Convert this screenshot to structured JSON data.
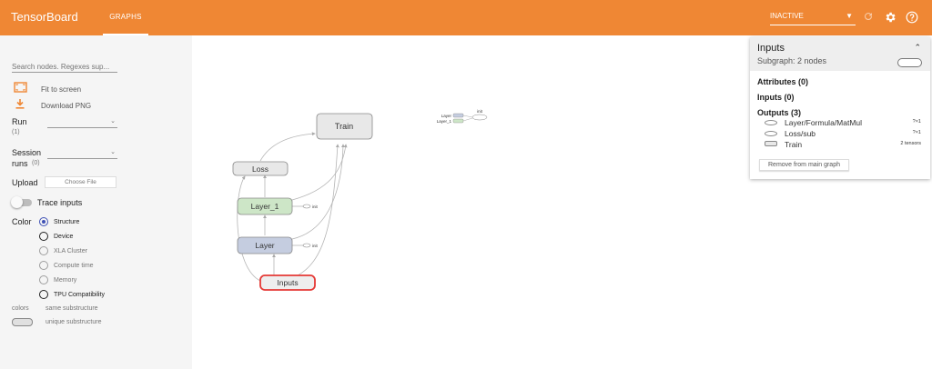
{
  "app": {
    "title": "TensorBoard",
    "tab": "GRAPHS"
  },
  "topbar": {
    "run_state": "INACTIVE",
    "icons": [
      "refresh-icon",
      "gear-icon",
      "help-icon"
    ]
  },
  "sidebar": {
    "search_placeholder": "Search nodes. Regexes sup...",
    "fit_label": "Fit to screen",
    "download_label": "Download PNG",
    "run_label": "Run",
    "run_count": "(1)",
    "session_label_1": "Session",
    "session_label_2": "runs",
    "session_count": "(0)",
    "upload_label": "Upload",
    "choose_file": "Choose File",
    "trace_label": "Trace inputs",
    "color_label": "Color",
    "color_options": [
      "Structure",
      "Device",
      "XLA Cluster",
      "Compute time",
      "Memory",
      "TPU Compatibility"
    ],
    "colors_label": "colors",
    "same_sub": "same substructure",
    "unique_sub": "unique substructure"
  },
  "graph": {
    "nodes": {
      "train": "Train",
      "loss": "Loss",
      "layer1": "Layer_1",
      "layer": "Layer",
      "inputs": "Inputs"
    },
    "init_label": "init",
    "mini_layer": "Layer",
    "mini_layer1": "Layer_1",
    "mini_init": "init",
    "edge_labels": {
      "shape_label": "?×1"
    }
  },
  "panel": {
    "title": "Inputs",
    "subtitle": "Subgraph: 2 nodes",
    "attributes": "Attributes (0)",
    "inputs": "Inputs (0)",
    "outputs": "Outputs (3)",
    "output_items": [
      {
        "name": "Layer/Formula/MatMul",
        "shape": "?×1"
      },
      {
        "name": "Loss/sub",
        "shape": "?×1"
      },
      {
        "name": "Train",
        "shape": "2 tensors"
      }
    ],
    "remove_button": "Remove from main graph"
  },
  "colors": {
    "accent": "#ef8734",
    "layer1_fill": "#cde6c7",
    "layer_fill": "#c5cde0",
    "selected_border": "#e53935"
  }
}
